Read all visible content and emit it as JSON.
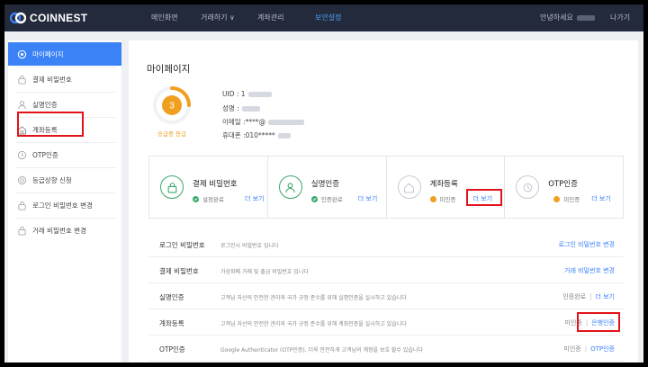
{
  "brand": {
    "name": "COINNEST",
    "accent": "#3b82f6",
    "nav_bg": "#232a3b"
  },
  "nav": {
    "items": [
      {
        "label": "메인화면"
      },
      {
        "label": "거래하기 ∨"
      },
      {
        "label": "계좌관리"
      },
      {
        "label": "보안설정"
      }
    ],
    "active_index": 3,
    "greeting": "안녕하세요",
    "logout": "나가기"
  },
  "sidebar": {
    "items": [
      {
        "label": "마이페이지",
        "icon": "gear-icon"
      },
      {
        "label": "결제 비밀번호",
        "icon": "lock-icon"
      },
      {
        "label": "실명인증",
        "icon": "person-icon"
      },
      {
        "label": "계좌등록",
        "icon": "home-icon"
      },
      {
        "label": "OTP인증",
        "icon": "otp-icon"
      },
      {
        "label": "등급상향 신청",
        "icon": "upgrade-icon"
      },
      {
        "label": "로그인 비밀번호 변경",
        "icon": "lock-icon"
      },
      {
        "label": "거래 비밀번호 변경",
        "icon": "lock-icon"
      }
    ],
    "active_index": 0,
    "highlight_index": 3
  },
  "main": {
    "title": "마이페이지",
    "grade": {
      "value": "3",
      "label": "승급중 등급"
    },
    "info": {
      "uid_label": "UID : 1",
      "name_label": "성명 :",
      "email_label": "이메일 :",
      "email_value": "****@",
      "phone_label": "휴대폰 :",
      "phone_value": "010*****"
    },
    "cards": [
      {
        "title": "결제 비밀번호",
        "status": "설정완료",
        "more": "더 보기",
        "done": true,
        "icon": "lock-icon"
      },
      {
        "title": "실명인증",
        "status": "인증완료",
        "more": "더 보기",
        "done": true,
        "icon": "person-icon"
      },
      {
        "title": "계좌등록",
        "status": "미인증",
        "more": "더 보기",
        "done": false,
        "icon": "home-icon"
      },
      {
        "title": "OTP인증",
        "status": "미인증",
        "more": "더 보기",
        "done": false,
        "icon": "otp-icon"
      }
    ],
    "rows": [
      {
        "name": "로그인 비밀번호",
        "desc": "로그인시 비밀번호 입니다",
        "action": "로그인 비밀번호 변경"
      },
      {
        "name": "결제 비밀번호",
        "desc": "가상화폐 거래 및 출금 비밀번호 입니다",
        "action": "거래 비밀번호 변경"
      },
      {
        "name": "실명인증",
        "desc": "고객님 자산의 안전한 관리와 국가 규정 준수를 위해 실명인증을 실시하고 있습니다",
        "status": "인증완료",
        "action": "더 보기"
      },
      {
        "name": "계좌등록",
        "desc": "고객님 자산의 안전한 관리와 국가 규정 준수를 위해 계좌인증을 실시하고 있습니다",
        "status": "미인증",
        "action": "은행인증"
      },
      {
        "name": "OTP인증",
        "desc": "Google Authenticator (OTP인증), 더욱 안전하게 고객님의 계정을 보호 할수 있습니다",
        "status": "미인증",
        "action": "OTP인증"
      }
    ]
  },
  "colors": {
    "success": "#3aa86b",
    "pending": "#f0a020",
    "highlight": "#e2131a"
  }
}
